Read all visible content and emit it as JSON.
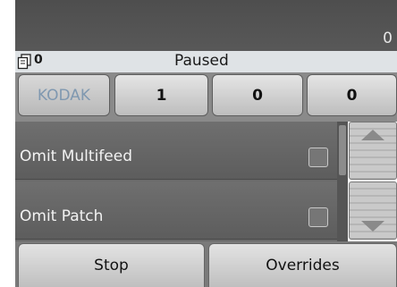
{
  "header": {
    "count": "0"
  },
  "status": {
    "doc_count": "0",
    "text": "Paused",
    "icon": "document-stack-icon"
  },
  "counters": {
    "brand": "KODAK",
    "values": [
      "1",
      "0",
      "0"
    ]
  },
  "options": [
    {
      "label": "Omit Multifeed",
      "checked": false
    },
    {
      "label": "Omit Patch",
      "checked": false
    }
  ],
  "scroll": {
    "up_icon": "arrow-up-icon",
    "down_icon": "arrow-down-icon"
  },
  "buttons": {
    "stop": "Stop",
    "overrides": "Overrides"
  }
}
